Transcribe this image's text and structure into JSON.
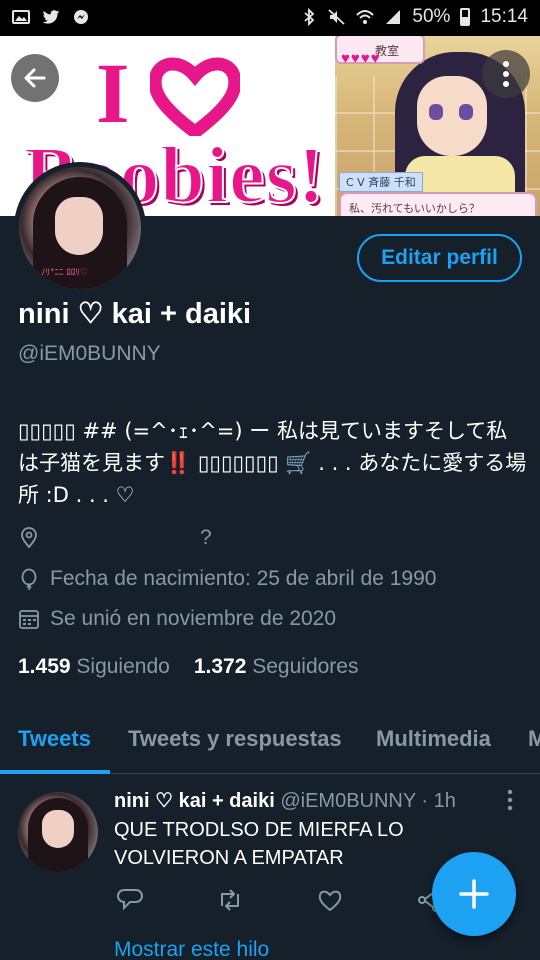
{
  "status_bar": {
    "battery": "50%",
    "time": "15:14"
  },
  "banner": {
    "text_line1": "I",
    "text_line2": "Boobies!",
    "game_hud_label": "教室",
    "game_cv_label": "C V 斉藤 千和",
    "game_dialogue": "私、汚れてもいいかしら？"
  },
  "profile": {
    "name": "nini ♡ kai + daiki",
    "handle": "@iEM0BUNNY",
    "edit_button": "Editar perfil",
    "avatar_caption": "ﾉﾘ°ﾆﾆ ﾛﾛﾘ♡",
    "bio_part1": "▯▯▯▯▯ ## (=^･ｪ･^=) ー 私は見ていますそして私は子猫を見ます",
    "bio_bang": "‼️",
    "bio_part2": " ▯▯▯▯▯▯▯ 🛒 . . .  あなたに愛する場所 :D  . . . ♡",
    "location": "?",
    "birthdate": "Fecha de nacimiento: 25 de abril de 1990",
    "joined": "Se unió en noviembre de 2020",
    "following_count": "1.459",
    "following_label": "Siguiendo",
    "followers_count": "1.372",
    "followers_label": "Seguidores"
  },
  "tabs": [
    {
      "label": "Tweets",
      "active": true
    },
    {
      "label": "Tweets y respuestas",
      "active": false
    },
    {
      "label": "Multimedia",
      "active": false
    },
    {
      "label": "M",
      "active": false
    }
  ],
  "tweet": {
    "name": "nini ♡ kai + daiki",
    "handle": "@iEM0BUNNY",
    "time": "· 1h",
    "text": "QUE TRODLSO DE MIERFA LO VOLVIERON A EMPATAR",
    "show_thread": "Mostrar este hilo"
  },
  "colors": {
    "background": "#15202b",
    "accent": "#1da1f2",
    "secondary_text": "#8899a6",
    "banner_pink": "#e7178a"
  },
  "icons": [
    "back-arrow-icon",
    "more-vertical-icon",
    "location-icon",
    "balloon-icon",
    "calendar-icon",
    "reply-icon",
    "retweet-icon",
    "like-icon",
    "share-icon",
    "compose-plus-icon"
  ]
}
